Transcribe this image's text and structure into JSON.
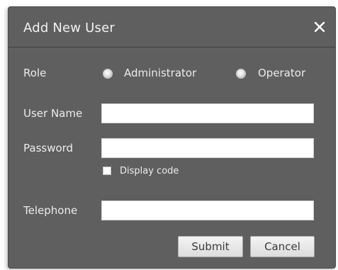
{
  "dialog": {
    "title": "Add New User",
    "close_icon": "close-icon"
  },
  "form": {
    "role": {
      "label": "Role",
      "options": [
        {
          "label": "Administrator",
          "selected": false
        },
        {
          "label": "Operator",
          "selected": false
        }
      ]
    },
    "user_name": {
      "label": "User Name",
      "value": "",
      "placeholder": ""
    },
    "password": {
      "label": "Password",
      "value": "",
      "placeholder": ""
    },
    "display_code": {
      "label": "Display code",
      "checked": false
    },
    "telephone": {
      "label": "Telephone",
      "value": "",
      "placeholder": ""
    }
  },
  "buttons": {
    "submit_label": "Submit",
    "cancel_label": "Cancel"
  },
  "colors": {
    "dialog_bg": "#5f5f5f",
    "text": "#ececec",
    "button_bg": "#e8e8e8"
  }
}
